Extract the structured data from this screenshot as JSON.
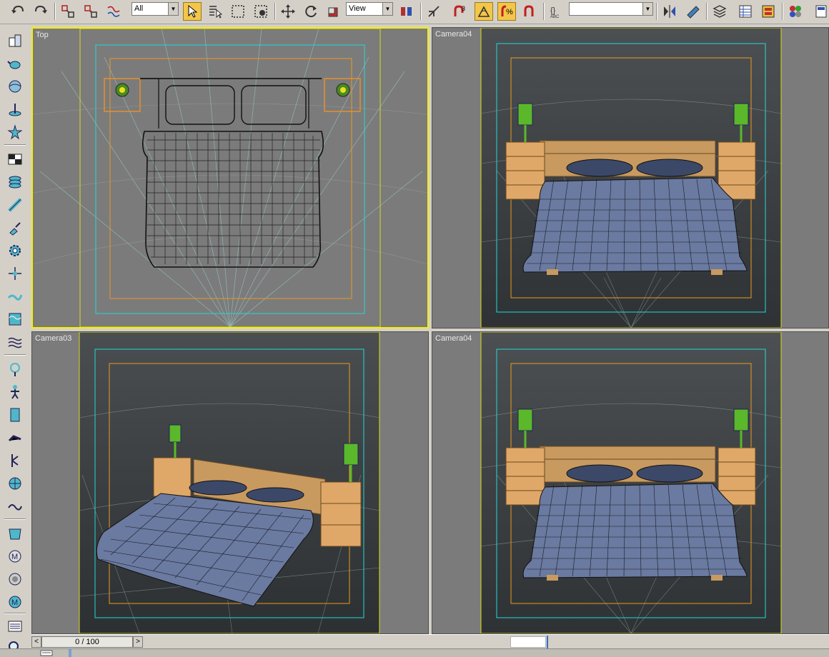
{
  "toolbar": {
    "selection_filter": "All",
    "reference_coord": "View",
    "named_selection": ""
  },
  "viewports": {
    "top_left": "Top",
    "top_right": "Camera04",
    "bottom_left": "Camera03",
    "bottom_right": "Camera04"
  },
  "timeline": {
    "frame_display": "0 / 100",
    "prev_label": "<",
    "next_label": ">"
  },
  "colors": {
    "viewport_bg": "#7b7b7b",
    "active_border": "#f6f000",
    "safe_frame_cyan": "#22d8d8",
    "safe_frame_orange": "#e89a20",
    "safe_frame_yellow": "#d8d820",
    "wood": "#c89a60",
    "lamp_green": "#5ab82a",
    "blanket": "#6a7aa0"
  },
  "icons": {
    "left_toolbar": [
      "create-icon",
      "modify-icon",
      "hierarchy-icon",
      "motion-icon",
      "display-icon",
      "utilities-icon",
      "material-icon",
      "render-icon",
      "camera-icon"
    ]
  }
}
